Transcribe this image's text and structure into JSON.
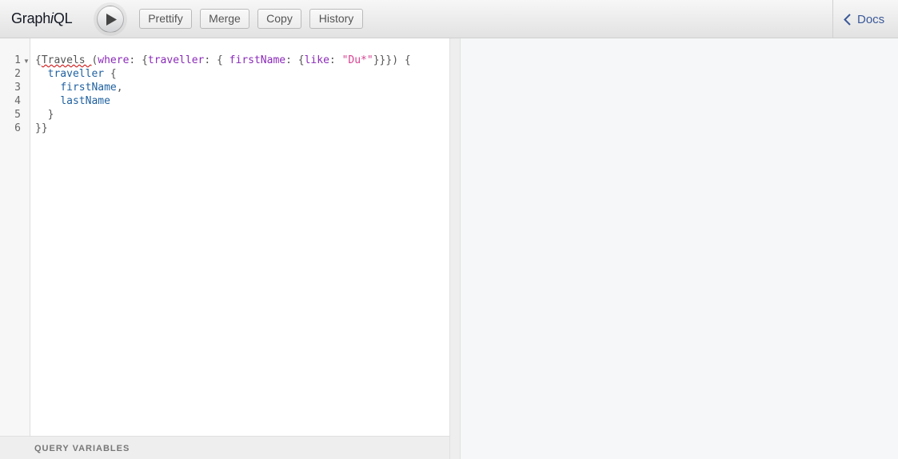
{
  "header": {
    "title_prefix": "Graph",
    "title_italic": "i",
    "title_suffix": "QL",
    "execute_icon": "play-icon",
    "buttons": {
      "prettify": "Prettify",
      "merge": "Merge",
      "copy": "Copy",
      "history": "History"
    },
    "docs": {
      "label": "Docs",
      "icon": "chevron-left-icon"
    }
  },
  "editor": {
    "line_numbers": [
      "1",
      "2",
      "3",
      "4",
      "5",
      "6"
    ],
    "lines": [
      [
        {
          "t": "{",
          "c": "pun"
        },
        {
          "t": "Travels ",
          "c": "err"
        },
        {
          "t": "(",
          "c": "pun"
        },
        {
          "t": "where",
          "c": "arg"
        },
        {
          "t": ": {",
          "c": "pun"
        },
        {
          "t": "traveller",
          "c": "arg"
        },
        {
          "t": ": { ",
          "c": "pun"
        },
        {
          "t": "firstName",
          "c": "arg"
        },
        {
          "t": ": {",
          "c": "pun"
        },
        {
          "t": "like",
          "c": "arg"
        },
        {
          "t": ": ",
          "c": "pun"
        },
        {
          "t": "\"Du*\"",
          "c": "str"
        },
        {
          "t": "}}}) {",
          "c": "pun"
        }
      ],
      [
        {
          "t": "  ",
          "c": "pun"
        },
        {
          "t": "traveller",
          "c": "fld"
        },
        {
          "t": " {",
          "c": "pun"
        }
      ],
      [
        {
          "t": "    ",
          "c": "pun"
        },
        {
          "t": "firstName",
          "c": "fld"
        },
        {
          "t": ",",
          "c": "pun"
        }
      ],
      [
        {
          "t": "    ",
          "c": "pun"
        },
        {
          "t": "lastName",
          "c": "fld"
        }
      ],
      [
        {
          "t": "  }",
          "c": "pun"
        }
      ],
      [
        {
          "t": "}}",
          "c": "pun"
        }
      ]
    ]
  },
  "variables_panel": {
    "label": "QUERY VARIABLES"
  }
}
